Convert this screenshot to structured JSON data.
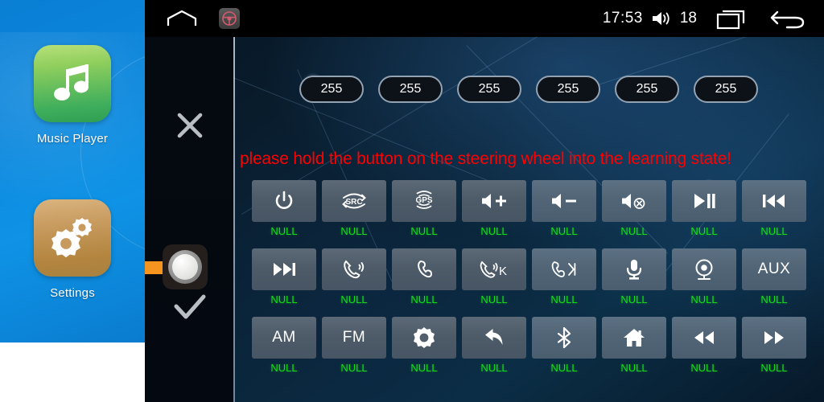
{
  "launcher": {
    "apps": [
      {
        "label": "Music Player",
        "icon": "music-note-icon"
      },
      {
        "label": "Settings",
        "icon": "gears-icon"
      }
    ]
  },
  "statusbar": {
    "home_icon": "home-outline-icon",
    "steering_wheel_icon": "steering-wheel-icon",
    "time": "17:53",
    "volume_icon": "volume-icon",
    "volume_level": "18",
    "recents_icon": "recent-apps-icon",
    "back_icon": "back-arrow-icon"
  },
  "controls": {
    "cancel_icon": "close-x-icon",
    "confirm_icon": "check-icon",
    "knob_icon": "rotary-knob-icon",
    "pointer_icon": "orange-right-arrow-icon"
  },
  "values": {
    "pills": [
      "255",
      "255",
      "255",
      "255",
      "255",
      "255"
    ]
  },
  "notice": {
    "text": "please hold the button on the steering wheel into the learning state!",
    "color": "#ff0000"
  },
  "grid": {
    "unassigned_label": "NULL",
    "label_color": "#12e015",
    "rows": [
      [
        {
          "name": "power",
          "icon": "power-icon",
          "text": "",
          "label": "NULL"
        },
        {
          "name": "source",
          "icon": "src-icon",
          "text": "",
          "label": "NULL"
        },
        {
          "name": "gps",
          "icon": "gps-icon",
          "text": "",
          "label": "NULL"
        },
        {
          "name": "volume-up",
          "icon": "volume-up-icon",
          "text": "",
          "label": "NULL"
        },
        {
          "name": "volume-down",
          "icon": "volume-down-icon",
          "text": "",
          "label": "NULL"
        },
        {
          "name": "mute",
          "icon": "volume-mute-icon",
          "text": "",
          "label": "NULL"
        },
        {
          "name": "play-pause",
          "icon": "play-pause-icon",
          "text": "",
          "label": "NULL"
        },
        {
          "name": "previous",
          "icon": "previous-track-icon",
          "text": "",
          "label": "NULL"
        }
      ],
      [
        {
          "name": "next",
          "icon": "next-track-icon",
          "text": "",
          "label": "NULL"
        },
        {
          "name": "answer-call",
          "icon": "phone-answer-icon",
          "text": "",
          "label": "NULL"
        },
        {
          "name": "end-call",
          "icon": "phone-hangup-icon",
          "text": "",
          "label": "NULL"
        },
        {
          "name": "call-key",
          "icon": "phone-answer-k-icon",
          "text": "",
          "label": "NULL"
        },
        {
          "name": "end-call-key",
          "icon": "phone-hangup-k-icon",
          "text": "",
          "label": "NULL"
        },
        {
          "name": "microphone",
          "icon": "microphone-icon",
          "text": "",
          "label": "NULL"
        },
        {
          "name": "camera",
          "icon": "camera-icon",
          "text": "",
          "label": "NULL"
        },
        {
          "name": "aux",
          "icon": "",
          "text": "AUX",
          "label": "NULL"
        }
      ],
      [
        {
          "name": "am-band",
          "icon": "",
          "text": "AM",
          "label": "NULL"
        },
        {
          "name": "fm-band",
          "icon": "",
          "text": "FM",
          "label": "NULL"
        },
        {
          "name": "settings",
          "icon": "gear-icon",
          "text": "",
          "label": "NULL"
        },
        {
          "name": "back",
          "icon": "back-curved-icon",
          "text": "",
          "label": "NULL"
        },
        {
          "name": "bluetooth",
          "icon": "bluetooth-icon",
          "text": "",
          "label": "NULL"
        },
        {
          "name": "home",
          "icon": "home-icon",
          "text": "",
          "label": "NULL"
        },
        {
          "name": "rewind",
          "icon": "rewind-icon",
          "text": "",
          "label": "NULL"
        },
        {
          "name": "fast-forward",
          "icon": "fast-forward-icon",
          "text": "",
          "label": "NULL"
        }
      ]
    ]
  }
}
